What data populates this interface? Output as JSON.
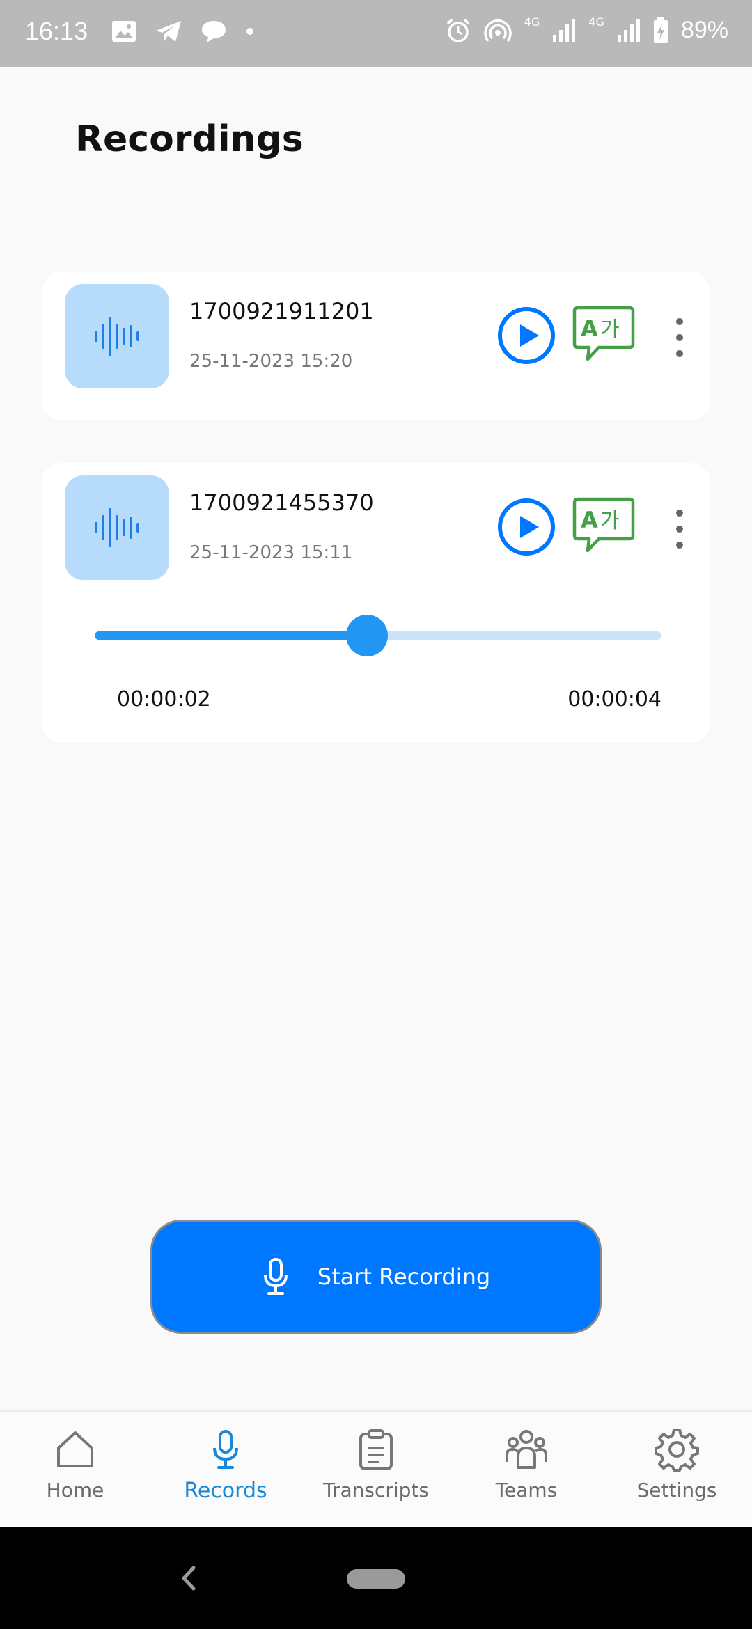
{
  "status_bar": {
    "time": "16:13",
    "battery": "89%",
    "network_1": "4G",
    "network_2": "4G"
  },
  "header": {
    "title": "Recordings"
  },
  "recordings": [
    {
      "name": "1700921911201",
      "date": "25-11-2023 15:20"
    },
    {
      "name": "1700921455370",
      "date": "25-11-2023 15:11",
      "player": {
        "current_time": "00:00:02",
        "total_time": "00:00:04",
        "progress": 0.48
      }
    }
  ],
  "record_button": {
    "label": "Start Recording"
  },
  "bottom_nav": {
    "items": [
      {
        "label": "Home",
        "icon": "home-icon"
      },
      {
        "label": "Records",
        "icon": "microphone-icon",
        "active": true
      },
      {
        "label": "Transcripts",
        "icon": "clipboard-icon"
      },
      {
        "label": "Teams",
        "icon": "people-icon"
      },
      {
        "label": "Settings",
        "icon": "gear-icon"
      }
    ]
  },
  "colors": {
    "primary": "#0077ff",
    "accent_blue": "#2196f3",
    "translate_green": "#43a047",
    "thumb_bg": "#b7dbfb"
  }
}
